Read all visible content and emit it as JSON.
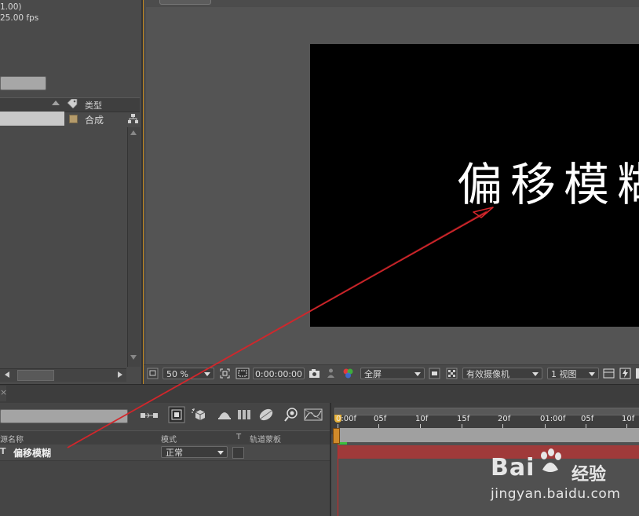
{
  "project": {
    "info_line1": "1.00)",
    "info_line2": "25.00 fps",
    "type_header": "类型",
    "row_type": "合成"
  },
  "comp": {
    "viewer_text": "偏移模糊",
    "zoom": "50 %",
    "timecode": "0:00:00:00",
    "resolution": "全屏",
    "camera": "有效摄像机",
    "views": "1 视图"
  },
  "timeline": {
    "close": "×",
    "col_name": "源名称",
    "col_mode": "模式",
    "col_t": "T",
    "col_track": "轨道蒙板",
    "layer_type": "T",
    "layer_name": "偏移模糊",
    "layer_mode": "正常",
    "ruler": [
      "0:00f",
      "05f",
      "10f",
      "15f",
      "20f",
      "01:00f",
      "05f",
      "10f"
    ]
  },
  "watermark": {
    "brand": "Bai",
    "brand_suffix": "经验",
    "url": "jingyan.baidu.com"
  },
  "colors": {
    "panel_bg": "#4b4b4b",
    "active_border": "#c68a1f",
    "annotation_arrow": "#d3262b",
    "layer_bar": "#a03a3a"
  },
  "icons": [
    "tag-icon",
    "flowchart-icon",
    "snapshot-icon",
    "channel-icon",
    "grid-icon",
    "draft-3d-icon",
    "motion-blur-icon",
    "graph-editor-icon"
  ]
}
